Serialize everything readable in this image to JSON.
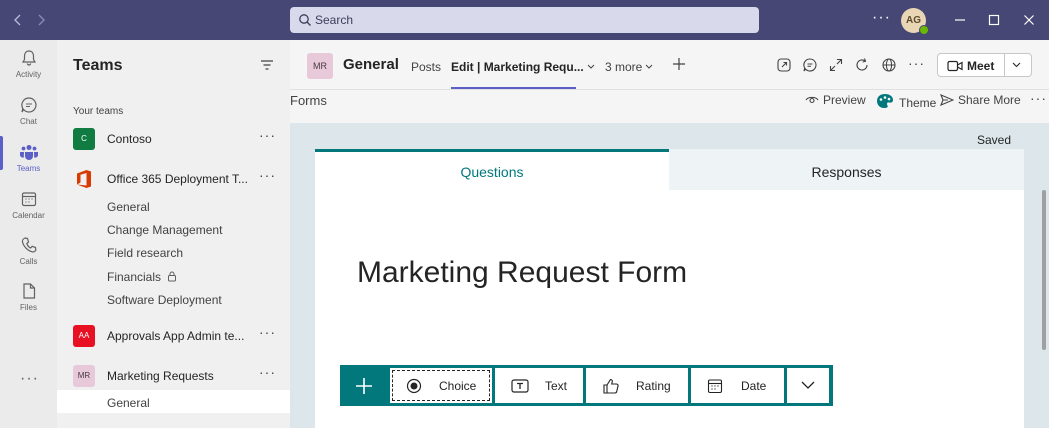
{
  "titlebar": {
    "search_placeholder": "Search",
    "more": "···",
    "user_initials": "AG"
  },
  "rail": {
    "items": [
      {
        "label": "Activity",
        "icon": "bell-icon"
      },
      {
        "label": "Chat",
        "icon": "chat-icon"
      },
      {
        "label": "Teams",
        "icon": "teams-icon",
        "active": true
      },
      {
        "label": "Calendar",
        "icon": "calendar-icon"
      },
      {
        "label": "Calls",
        "icon": "phone-icon"
      },
      {
        "label": "Files",
        "icon": "file-icon"
      }
    ],
    "more": "···"
  },
  "teams_panel": {
    "title": "Teams",
    "section_label": "Your teams",
    "teams": [
      {
        "name": "Contoso",
        "initials": "C",
        "color": "#107c41"
      },
      {
        "name": "Office 365 Deployment T...",
        "initials": "",
        "color": "#d83b01"
      },
      {
        "name": "Approvals App Admin te...",
        "initials": "AA",
        "color": "#e81123"
      },
      {
        "name": "Marketing Requests",
        "initials": "MR",
        "color": "#e8c9d9"
      }
    ],
    "channels": [
      "General",
      "Change Management",
      "Field research",
      "Financials",
      "Software Deployment"
    ],
    "selected_channel": "General",
    "more": "···"
  },
  "header": {
    "team_initials": "MR",
    "channel_name": "General",
    "tabs": [
      "Posts",
      "Edit | Marketing Requ...",
      "3 more"
    ],
    "active_tab": "Edit | Marketing Requ...",
    "more": "···",
    "meet_label": "Meet"
  },
  "forms_bar": {
    "app_label": "Forms",
    "preview": "Preview",
    "theme": "Theme",
    "share_more": "Share More",
    "more": "···"
  },
  "form": {
    "saved_status": "Saved",
    "questions_tab": "Questions",
    "responses_tab": "Responses",
    "title": "Marketing Request Form",
    "add_types": [
      "Choice",
      "Text",
      "Rating",
      "Date"
    ]
  },
  "colors": {
    "titlebar": "#464775",
    "accent": "#5b5fc7",
    "forms_teal": "#03787c"
  }
}
